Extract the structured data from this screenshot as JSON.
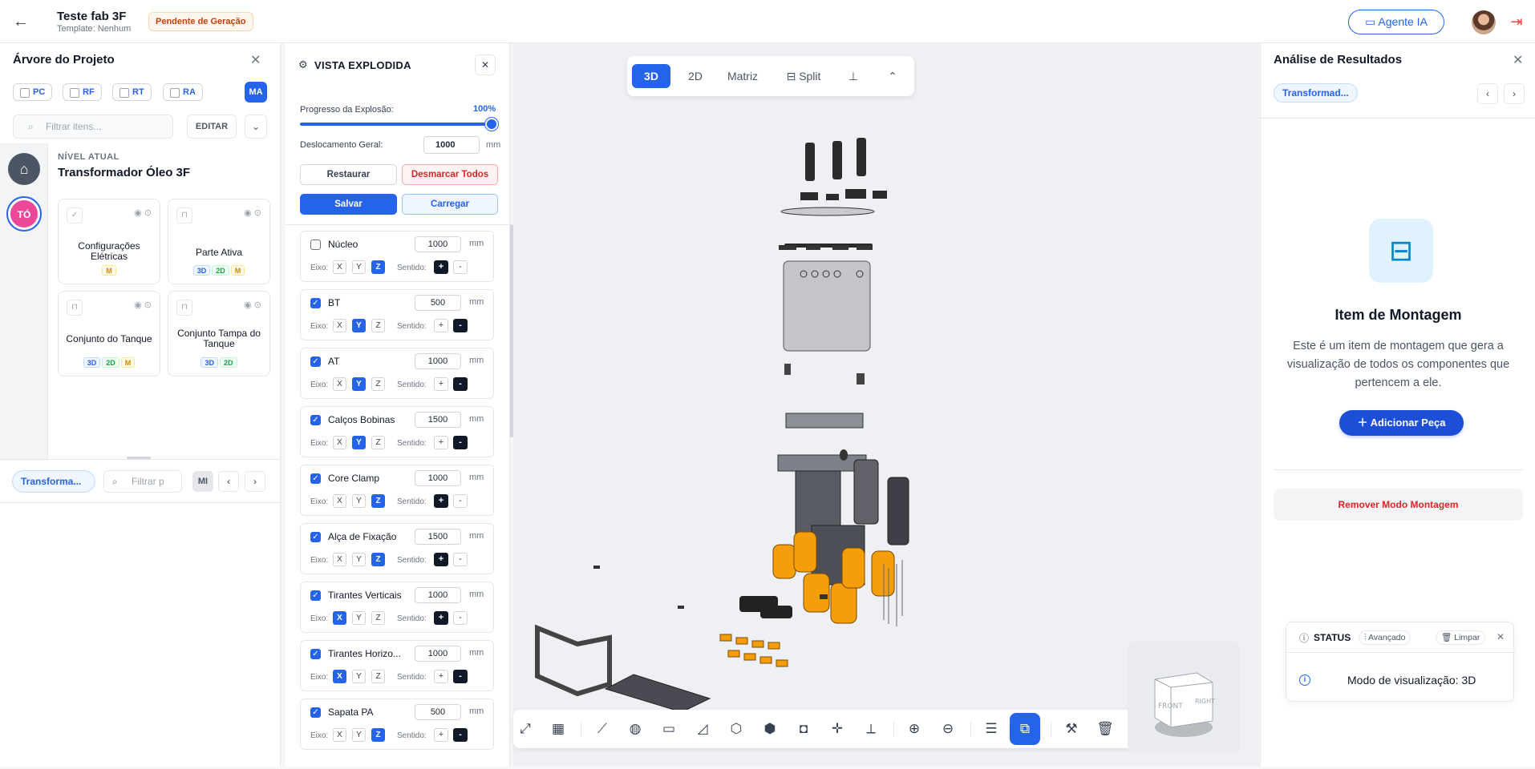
{
  "header": {
    "title": "Teste fab 3F",
    "template": "Template: Nenhum",
    "status": "Pendente de Geração",
    "agent_button": "Agente IA"
  },
  "tree": {
    "title": "Árvore do Projeto",
    "chips": [
      "PC",
      "RF",
      "RT",
      "RA"
    ],
    "ma": "MA",
    "filter_placeholder": "Filtrar itens...",
    "edit_label": "EDITAR",
    "rail_item": "TÓ",
    "level_label": "NÍVEL ATUAL",
    "level_name": "Transformador Óleo 3F",
    "cards": [
      {
        "name": "Configurações Elétricas",
        "tags": [
          "M"
        ]
      },
      {
        "name": "Parte Ativa",
        "tags": [
          "3D",
          "2D",
          "M"
        ]
      },
      {
        "name": "Conjunto do Tanque",
        "tags": [
          "3D",
          "2D",
          "M"
        ]
      },
      {
        "name": "Conjunto Tampa do Tanque",
        "tags": [
          "3D",
          "2D"
        ]
      }
    ],
    "bottom_tag": "Transforma...",
    "bottom_filter": "Filtrar p",
    "mi": "MI"
  },
  "explode": {
    "title": "VISTA EXPLODIDA",
    "progress_label": "Progresso da Explosão:",
    "progress_value": "100%",
    "progress": 1.0,
    "offset_label": "Deslocamento Geral:",
    "offset_value": "1000",
    "unit": "mm",
    "restore": "Restaurar",
    "unselect_all": "Desmarcar Todos",
    "save": "Salvar",
    "load": "Carregar",
    "axis_label": "Eixo:",
    "dir_label": "Sentido:",
    "items": [
      {
        "name": "Núcleo",
        "checked": false,
        "value": "1000",
        "axis": "Z",
        "dir": "+"
      },
      {
        "name": "BT",
        "checked": true,
        "value": "500",
        "axis": "Y",
        "dir": "-"
      },
      {
        "name": "AT",
        "checked": true,
        "value": "1000",
        "axis": "Y",
        "dir": "-"
      },
      {
        "name": "Calços Bobinas",
        "checked": true,
        "value": "1500",
        "axis": "Y",
        "dir": "-"
      },
      {
        "name": "Core Clamp",
        "checked": true,
        "value": "1000",
        "axis": "Z",
        "dir": "+"
      },
      {
        "name": "Alça de Fixação",
        "checked": true,
        "value": "1500",
        "axis": "Z",
        "dir": "+"
      },
      {
        "name": "Tirantes Verticais",
        "checked": true,
        "value": "1000",
        "axis": "X",
        "dir": "+"
      },
      {
        "name": "Tirantes Horizo...",
        "checked": true,
        "value": "1000",
        "axis": "X",
        "dir": "-"
      },
      {
        "name": "Sapata PA",
        "checked": true,
        "value": "500",
        "axis": "Z",
        "dir": "-"
      }
    ]
  },
  "viewer": {
    "modes": [
      "3D",
      "2D",
      "Matriz",
      "Split"
    ],
    "active_mode": "3D",
    "cube_faces": [
      "FRONT",
      "RIGHT"
    ]
  },
  "results": {
    "title": "Análise de Resultados",
    "tag": "Transformad...",
    "item_title": "Item de Montagem",
    "item_desc": "Este é um item de montagem que gera a visualização de todos os componentes que pertencem a ele.",
    "add_button": "Adicionar Peça",
    "remove_button": "Remover Modo Montagem"
  },
  "status": {
    "title": "STATUS",
    "advanced": "Avançado",
    "clear": "Limpar",
    "message": "Modo de visualização: 3D"
  },
  "colors": {
    "accent": "#2563eb",
    "pending": "#c2410c",
    "danger": "#dc2626",
    "coil": "#f59e0b"
  }
}
